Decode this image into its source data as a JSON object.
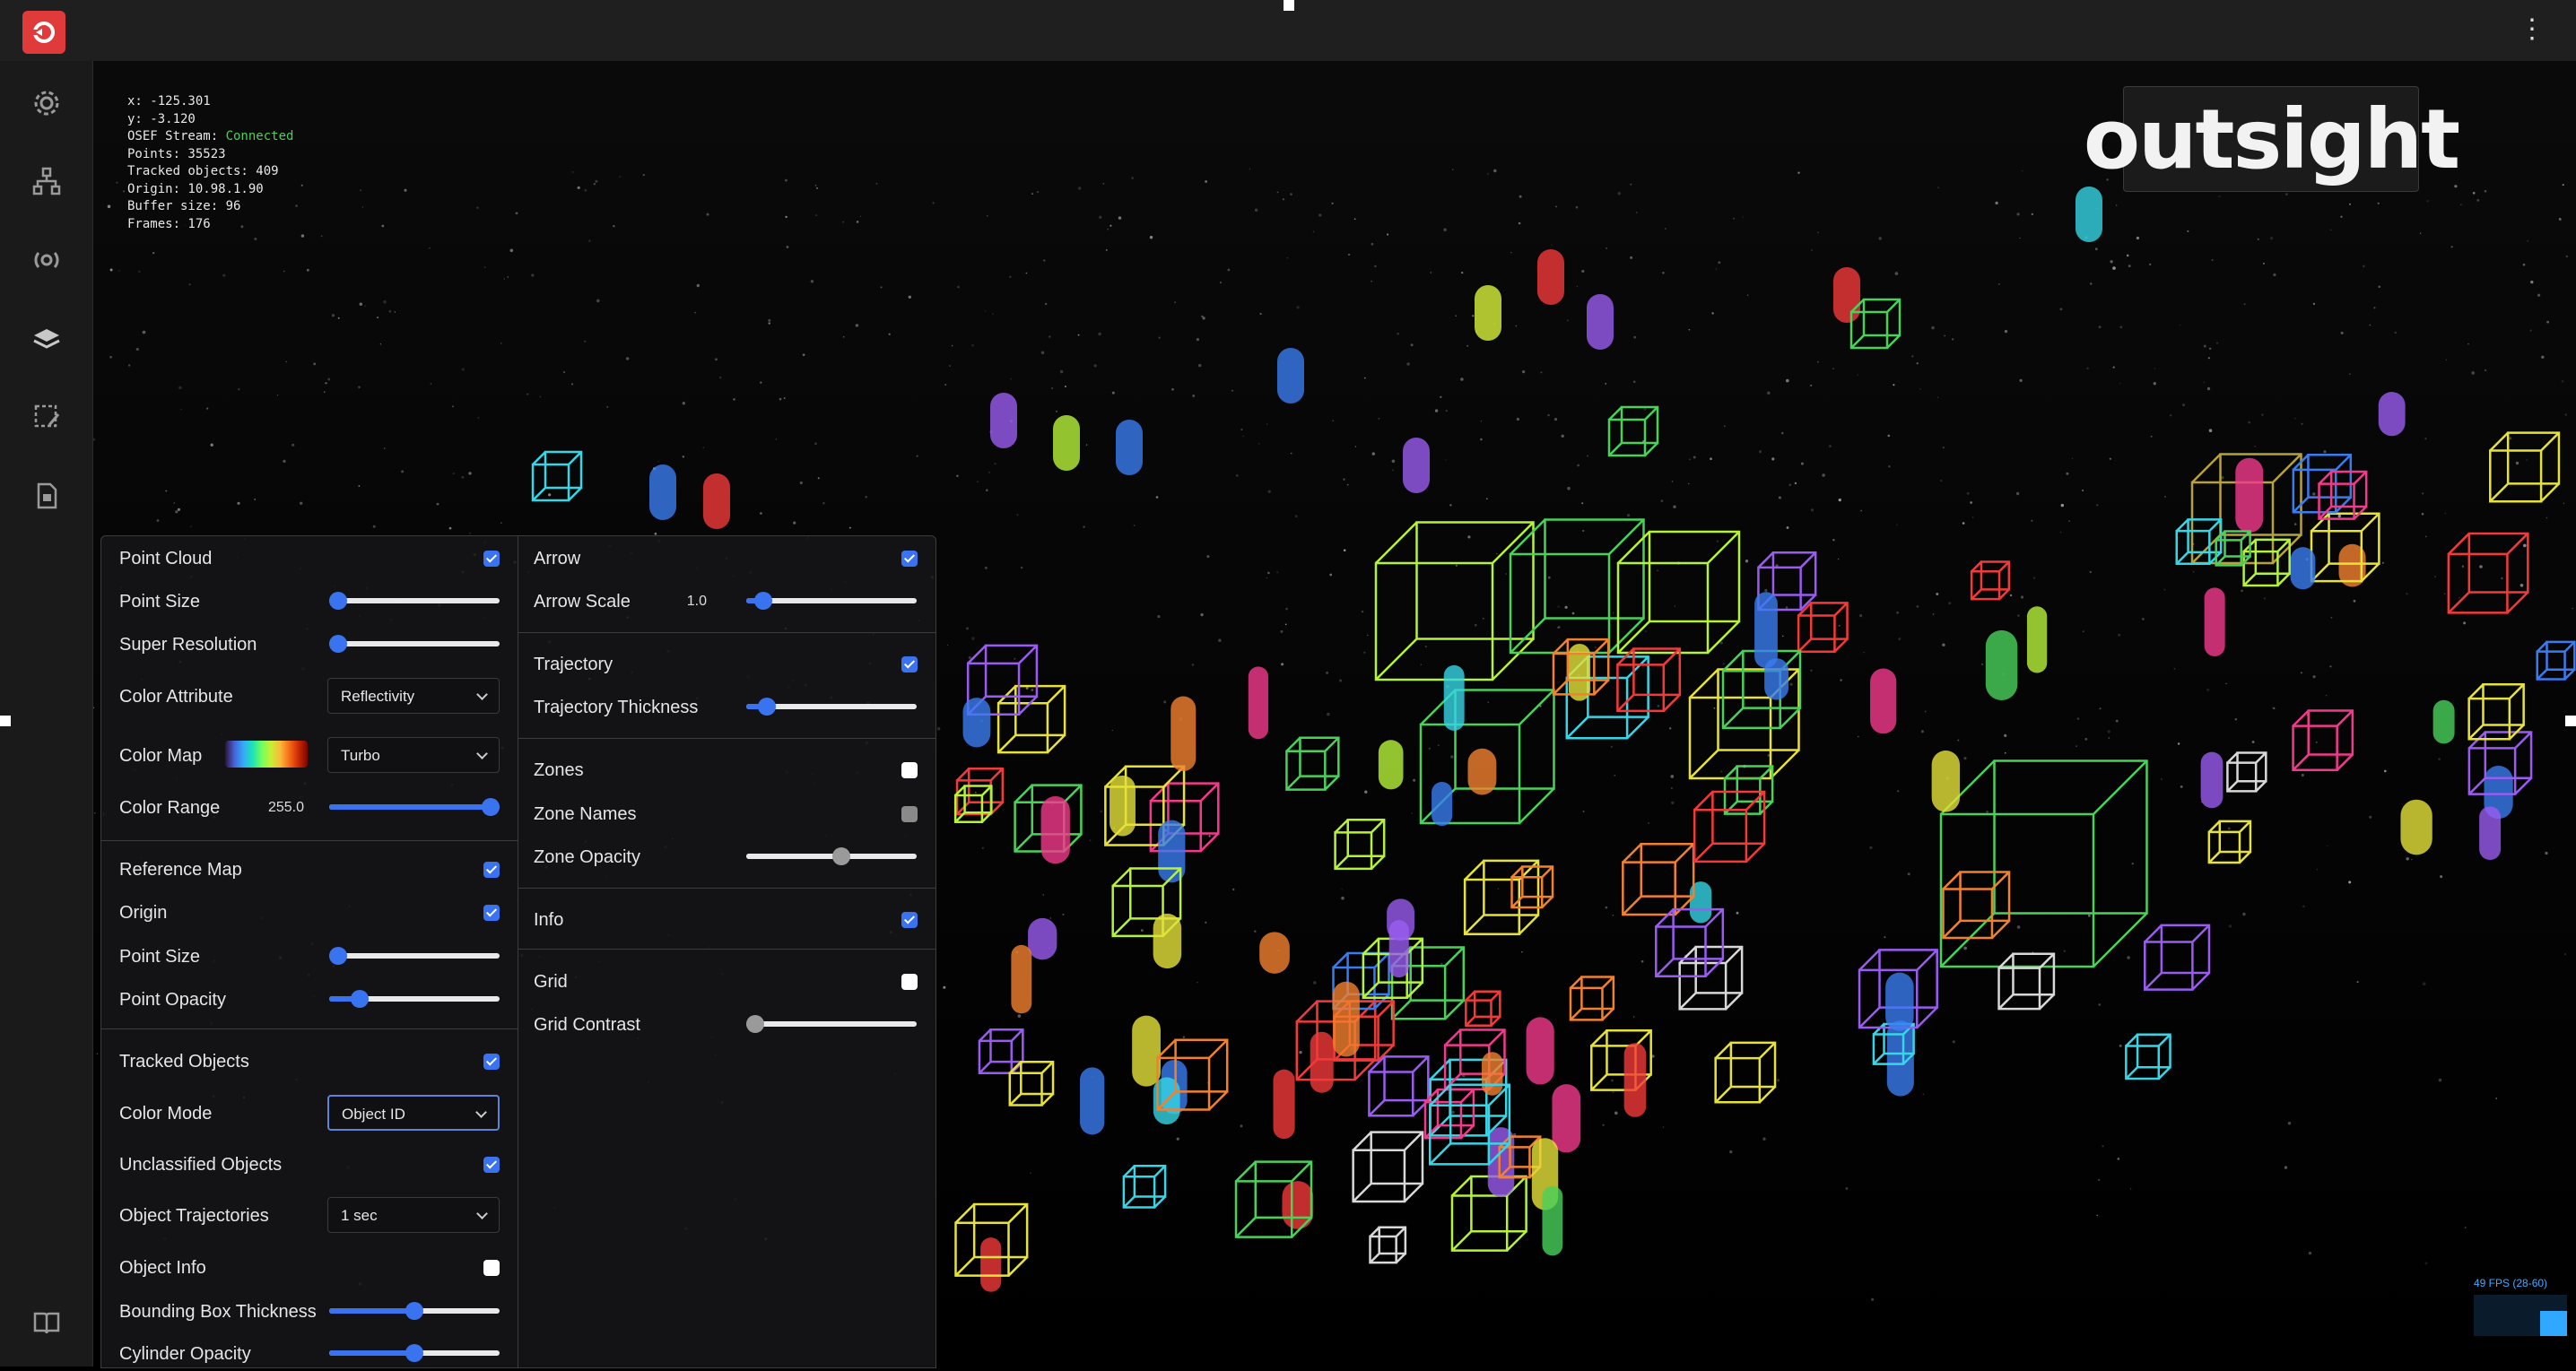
{
  "colors": {
    "accent": "#3a73f0",
    "brand_red": "#e03a3a",
    "connected": "#49d15a",
    "fps": "#44aaff"
  },
  "topbar": {
    "menu_icon": "kebab-menu-icon"
  },
  "sidebar": {
    "items": [
      {
        "icon": "gear-icon"
      },
      {
        "icon": "network-icon"
      },
      {
        "icon": "sensor-icon"
      },
      {
        "icon": "layers-icon"
      },
      {
        "icon": "zone-edit-icon"
      },
      {
        "icon": "document-icon"
      },
      {
        "icon": "book-icon"
      }
    ]
  },
  "info": {
    "x": "x: -125.301",
    "y": "y: -3.120",
    "stream_label": "OSEF Stream: ",
    "stream_status": "Connected",
    "points": "Points: 35523",
    "tracked": "Tracked objects: 409",
    "origin": "Origin: 10.98.1.90",
    "buffer": "Buffer size: 96",
    "frames": "Frames: 176"
  },
  "brand": {
    "logo_text": "outsight"
  },
  "fps": {
    "label": "49 FPS (28-60)",
    "level": 0.6
  },
  "panel": {
    "left": {
      "point_cloud": {
        "label": "Point Cloud",
        "checked": true
      },
      "point_size": {
        "label": "Point Size",
        "value": 0.0
      },
      "super_resolution": {
        "label": "Super Resolution",
        "value": 0.0
      },
      "color_attribute": {
        "label": "Color Attribute",
        "selected": "Reflectivity"
      },
      "color_map": {
        "label": "Color Map",
        "selected": "Turbo"
      },
      "color_range": {
        "label": "Color Range",
        "value_text": "255.0",
        "value": 1.0
      },
      "reference_map": {
        "label": "Reference Map",
        "checked": true
      },
      "origin": {
        "label": "Origin",
        "checked": true
      },
      "ref_point_size": {
        "label": "Point Size",
        "value": 0.0
      },
      "point_opacity": {
        "label": "Point Opacity",
        "value": 0.18
      },
      "tracked_objects": {
        "label": "Tracked Objects",
        "checked": true
      },
      "color_mode": {
        "label": "Color Mode",
        "selected": "Object ID"
      },
      "unclassified_objects": {
        "label": "Unclassified Objects",
        "checked": true
      },
      "object_trajectories": {
        "label": "Object Trajectories",
        "selected": "1 sec"
      },
      "object_info": {
        "label": "Object Info",
        "checked": false
      },
      "bbox_thickness": {
        "label": "Bounding Box Thickness",
        "value": 0.5
      },
      "cylinder_opacity": {
        "label": "Cylinder Opacity",
        "value": 0.5
      }
    },
    "right": {
      "arrow": {
        "label": "Arrow",
        "checked": true
      },
      "arrow_scale": {
        "label": "Arrow Scale",
        "value_text": "1.0",
        "value": 0.1
      },
      "trajectory": {
        "label": "Trajectory",
        "checked": true
      },
      "trajectory_thickness": {
        "label": "Trajectory Thickness",
        "value": 0.12
      },
      "zones": {
        "label": "Zones",
        "checked": false
      },
      "zone_names": {
        "label": "Zone Names",
        "checked": false
      },
      "zone_opacity": {
        "label": "Zone Opacity",
        "value": 0.56
      },
      "info": {
        "label": "Info",
        "checked": true
      },
      "grid": {
        "label": "Grid",
        "checked": false
      },
      "grid_contrast": {
        "label": "Grid Contrast",
        "value": 0.04
      }
    }
  }
}
